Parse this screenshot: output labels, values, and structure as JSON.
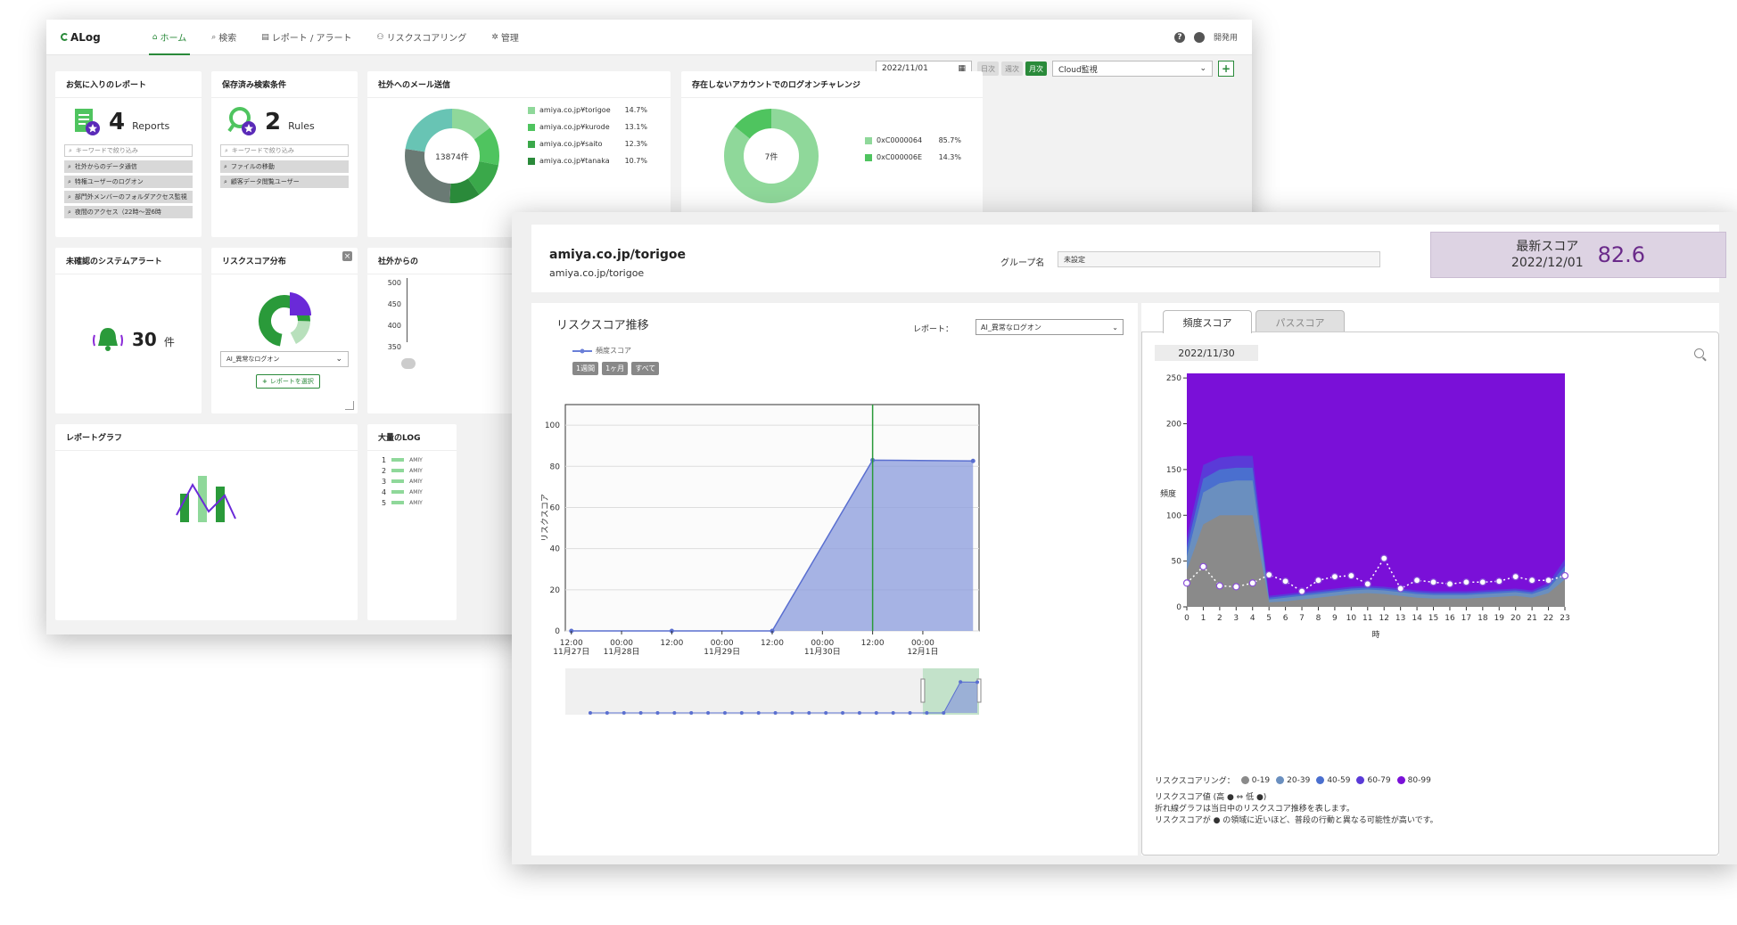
{
  "app": {
    "logo": "ALog",
    "nav": [
      {
        "icon": "home-icon",
        "glyph": "⌂",
        "label": "ホーム",
        "active": true
      },
      {
        "icon": "search-icon",
        "glyph": "⌕",
        "label": "検索",
        "active": false
      },
      {
        "icon": "report-icon",
        "glyph": "▤",
        "label": "レポート / アラート",
        "active": false
      },
      {
        "icon": "users-icon",
        "glyph": "⚇",
        "label": "リスクスコアリング",
        "active": false
      },
      {
        "icon": "gear-icon",
        "glyph": "✲",
        "label": "管理",
        "active": false
      }
    ],
    "user_label": "開発用",
    "help_glyph": "?"
  },
  "toolbar": {
    "date": "2022/11/01",
    "seg": [
      "日次",
      "週次",
      "月次"
    ],
    "seg_active": "月次",
    "select": "Cloud監視",
    "plus": "+"
  },
  "cards": {
    "fav_reports": {
      "title": "お気に入りのレポート",
      "count": "4",
      "unit": "Reports",
      "search_placeholder": "キーワードで絞り込み",
      "items": [
        "社外からのデータ通信",
        "特権ユーザーのログオン",
        "部門外メンバーのフォルダアクセス監視",
        "夜間のアクセス（22時〜翌6時"
      ]
    },
    "saved_search": {
      "title": "保存済み検索条件",
      "count": "2",
      "unit": "Rules",
      "search_placeholder": "キーワードで絞り込み",
      "items": [
        "ファイルの移動",
        "顧客データ閲覧ユーザー"
      ]
    },
    "mail": {
      "title": "社外へのメール送信",
      "center": "13874件",
      "legend": [
        {
          "label": "amiya.co.jp¥torigoe",
          "pct": "14.7%",
          "color": "#8fd89a"
        },
        {
          "label": "amiya.co.jp¥kurode",
          "pct": "13.1%",
          "color": "#4fc45f"
        },
        {
          "label": "amiya.co.jp¥saito",
          "pct": "12.3%",
          "color": "#3aa84a"
        },
        {
          "label": "amiya.co.jp¥tanaka",
          "pct": "10.7%",
          "color": "#2a8a3a"
        }
      ]
    },
    "logon": {
      "title": "存在しないアカウントでのログオンチャレンジ",
      "center": "7件",
      "legend": [
        {
          "label": "0xC0000064",
          "pct": "85.7%",
          "color": "#8fd89a"
        },
        {
          "label": "0xC000006E",
          "pct": "14.3%",
          "color": "#4fc45f"
        }
      ]
    },
    "alerts": {
      "title": "未確認のシステムアラート",
      "count": "30",
      "unit": "件"
    },
    "risk_dist": {
      "title": "リスクスコア分布",
      "select": "AI_異常なログオン",
      "button": "レポートを選択",
      "close": "×"
    },
    "ext_comm": {
      "title": "社外からの",
      "yticks": [
        "500",
        "450",
        "400",
        "350"
      ]
    },
    "report_graph": {
      "title": "レポートグラフ"
    },
    "bulk": {
      "title": "大量のLOG",
      "rows": [
        "1",
        "2",
        "3",
        "4",
        "5"
      ],
      "row_texts": [
        "AMIY",
        "AMIY",
        "AMIY",
        "AMIY",
        "AMIY"
      ]
    }
  },
  "detail": {
    "user_title": "amiya.co.jp/torigoe",
    "user_sub": "amiya.co.jp/torigoe",
    "group_label": "グループ名",
    "group_value": "未設定",
    "latest_label": "最新スコア",
    "latest_date": "2022/12/01",
    "latest_score": "82.6",
    "left_title": "リスクスコア推移",
    "report_label": "レポート：",
    "report_select": "AI_異常なログオン",
    "series_legend": "頻度スコア",
    "range_buttons": [
      "1週間",
      "1ヶ月",
      "すべて"
    ],
    "ylabel": "リスクスコア",
    "tabs": [
      "頻度スコア",
      "パススコア"
    ],
    "tab_active": "頻度スコア",
    "right_date": "2022/11/30",
    "freq_ylabel": "頻度",
    "freq_xlabel": "時",
    "rs_legend_label": "リスクスコアリング：",
    "rs_legend": [
      {
        "label": "0-19",
        "color": "#8a8a8a"
      },
      {
        "label": "20-39",
        "color": "#6a8fbf"
      },
      {
        "label": "40-59",
        "color": "#4a6fcf"
      },
      {
        "label": "60-79",
        "color": "#5a3ad8"
      },
      {
        "label": "80-99",
        "color": "#7a10d8"
      }
    ],
    "notes": [
      "リスクスコア値 (高 ● ⇔ 低 ●)",
      "折れ線グラフは当日中のリスクスコア推移を表します。",
      "リスクスコアが ● の領域に近いほど、普段の行動と異なる可能性が高いです。"
    ]
  },
  "chart_data": [
    {
      "type": "area",
      "title": "リスクスコア推移",
      "ylabel": "リスクスコア",
      "ylim": [
        0,
        110
      ],
      "yticks": [
        0,
        20,
        40,
        60,
        80,
        100
      ],
      "x_ticks": [
        {
          "t": 0.5,
          "l1": "12:00",
          "l2": "11月27日"
        },
        {
          "t": 1.0,
          "l1": "00:00",
          "l2": "11月28日"
        },
        {
          "t": 1.5,
          "l1": "12:00",
          "l2": ""
        },
        {
          "t": 2.0,
          "l1": "00:00",
          "l2": "11月29日"
        },
        {
          "t": 2.5,
          "l1": "12:00",
          "l2": ""
        },
        {
          "t": 3.0,
          "l1": "00:00",
          "l2": "11月30日"
        },
        {
          "t": 3.5,
          "l1": "12:00",
          "l2": ""
        },
        {
          "t": 4.0,
          "l1": "00:00",
          "l2": "12月1日"
        }
      ],
      "x_days": [
        "11月27日",
        "11月28日",
        "11月29日",
        "11月30日",
        "12月1日"
      ],
      "series": [
        {
          "name": "頻度スコア",
          "values": [
            0,
            0,
            0,
            83,
            82.6
          ]
        }
      ],
      "marker_day": "11月30日",
      "color": "#8a9bdc"
    },
    {
      "type": "area",
      "title": "頻度スコア",
      "xlabel": "時",
      "ylabel": "頻度",
      "ylim": [
        0,
        255
      ],
      "yticks": [
        0,
        50,
        100,
        150,
        200,
        250
      ],
      "hours": [
        0,
        1,
        2,
        3,
        4,
        5,
        6,
        7,
        8,
        9,
        10,
        11,
        12,
        13,
        14,
        15,
        16,
        17,
        18,
        19,
        20,
        21,
        22,
        23
      ],
      "bands": {
        "b0_19": [
          40,
          90,
          100,
          100,
          100,
          5,
          6,
          8,
          10,
          12,
          14,
          15,
          14,
          12,
          10,
          9,
          9,
          9,
          10,
          11,
          12,
          10,
          15,
          30
        ],
        "b20_39": [
          55,
          125,
          135,
          138,
          138,
          8,
          10,
          12,
          14,
          16,
          18,
          19,
          18,
          16,
          14,
          13,
          13,
          13,
          14,
          15,
          16,
          14,
          20,
          40
        ],
        "b40_59": [
          65,
          140,
          150,
          152,
          152,
          10,
          12,
          14,
          16,
          18,
          20,
          21,
          20,
          18,
          16,
          15,
          15,
          15,
          16,
          17,
          18,
          16,
          23,
          45
        ],
        "b60_79": [
          75,
          155,
          163,
          165,
          165,
          12,
          14,
          16,
          18,
          20,
          22,
          23,
          22,
          20,
          18,
          17,
          17,
          17,
          18,
          19,
          20,
          18,
          26,
          52
        ],
        "b80_99": [
          255,
          255,
          255,
          255,
          255,
          255,
          255,
          255,
          255,
          255,
          255,
          255,
          255,
          255,
          255,
          255,
          255,
          255,
          255,
          255,
          255,
          255,
          255,
          255
        ]
      },
      "line": [
        26,
        44,
        23,
        22,
        26,
        35,
        28,
        17,
        29,
        33,
        34,
        25,
        53,
        20,
        29,
        27,
        25,
        27,
        27,
        28,
        33,
        29,
        29,
        34
      ]
    }
  ]
}
